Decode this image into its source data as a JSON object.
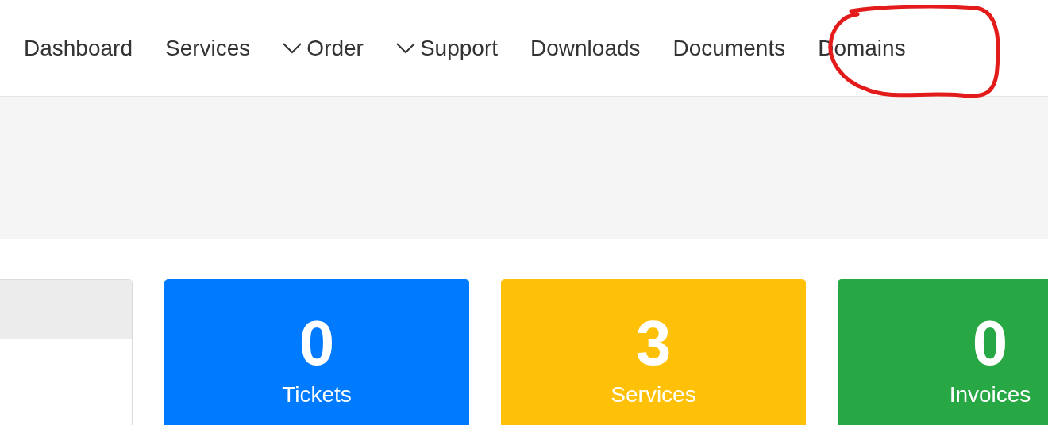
{
  "nav": [
    {
      "label": "Dashboard",
      "kind": "link"
    },
    {
      "label": "Services",
      "kind": "link"
    },
    {
      "label": "Order",
      "kind": "dropdown"
    },
    {
      "label": "Support",
      "kind": "dropdown"
    },
    {
      "label": "Downloads",
      "kind": "link"
    },
    {
      "label": "Documents",
      "kind": "link"
    },
    {
      "label": "Domains",
      "kind": "link"
    }
  ],
  "stats": [
    {
      "value": "0",
      "label": "Tickets",
      "color": "#007bff"
    },
    {
      "value": "3",
      "label": "Services",
      "color": "#ffc107"
    },
    {
      "value": "0",
      "label": "Invoices",
      "color": "#28a745"
    }
  ]
}
